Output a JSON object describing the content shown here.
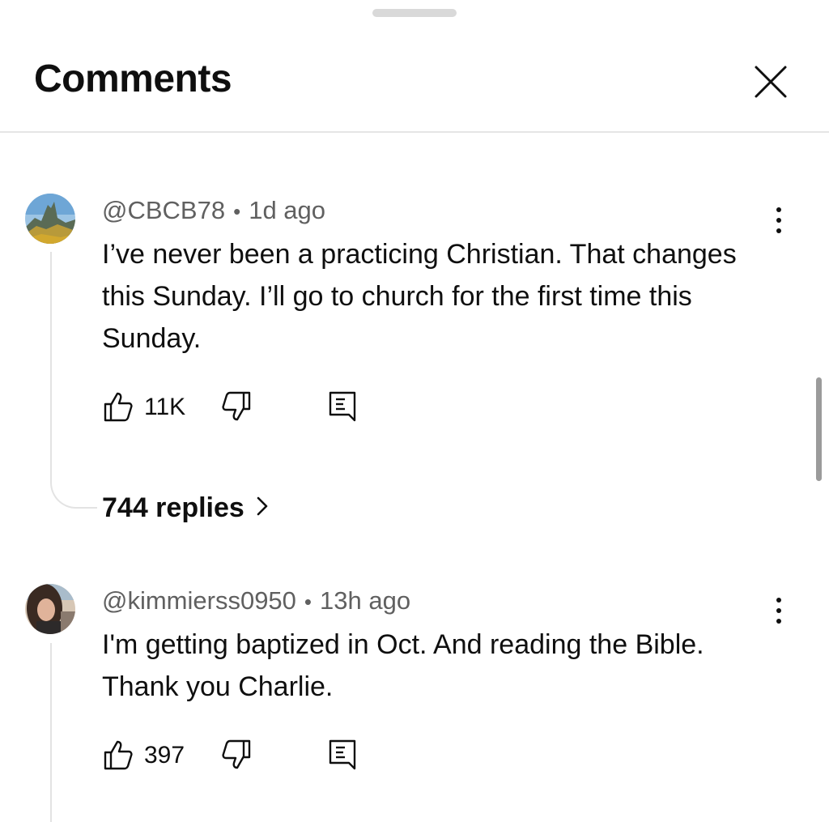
{
  "sheet": {
    "title": "Comments",
    "close_icon": "close-icon"
  },
  "comments": [
    {
      "author": "@CBCB78",
      "separator": "•",
      "time": "1d ago",
      "text": "I’ve never been a practicing Christian. That changes this Sunday. I’ll go to church for the first time this Sunday.",
      "likes": "11K",
      "replies_label": "744 replies",
      "avatar_icon": "landscape-avatar"
    },
    {
      "author": "@kimmierss0950",
      "separator": "•",
      "time": "13h ago",
      "text": "I'm getting baptized in Oct. And reading the Bible. Thank you Charlie.",
      "likes": "397",
      "avatar_icon": "person-avatar"
    }
  ],
  "colors": {
    "text": "#0f0f0f",
    "meta": "#606060",
    "divider": "#e5e5e5",
    "scrollbar": "#9b9b9b"
  }
}
